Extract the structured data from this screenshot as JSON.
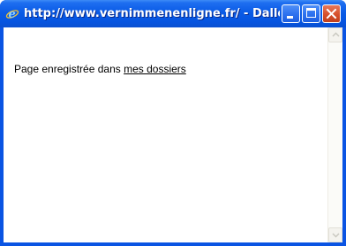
{
  "window": {
    "title": "http://www.vernimmenenligne.fr/ - Dallozbi...",
    "icon": "internet-explorer-icon"
  },
  "titlebar_buttons": {
    "minimize": "minimize-icon",
    "maximize": "maximize-icon",
    "close": "close-icon"
  },
  "content": {
    "message_prefix": "Page enregistrée dans ",
    "link_text": "mes dossiers"
  },
  "scrollbar": {
    "up": "scroll-up-arrow-icon",
    "down": "scroll-down-arrow-icon"
  },
  "colors": {
    "titlebar": "#0a5be6",
    "close_button": "#d6502b",
    "background": "#ffffff"
  }
}
